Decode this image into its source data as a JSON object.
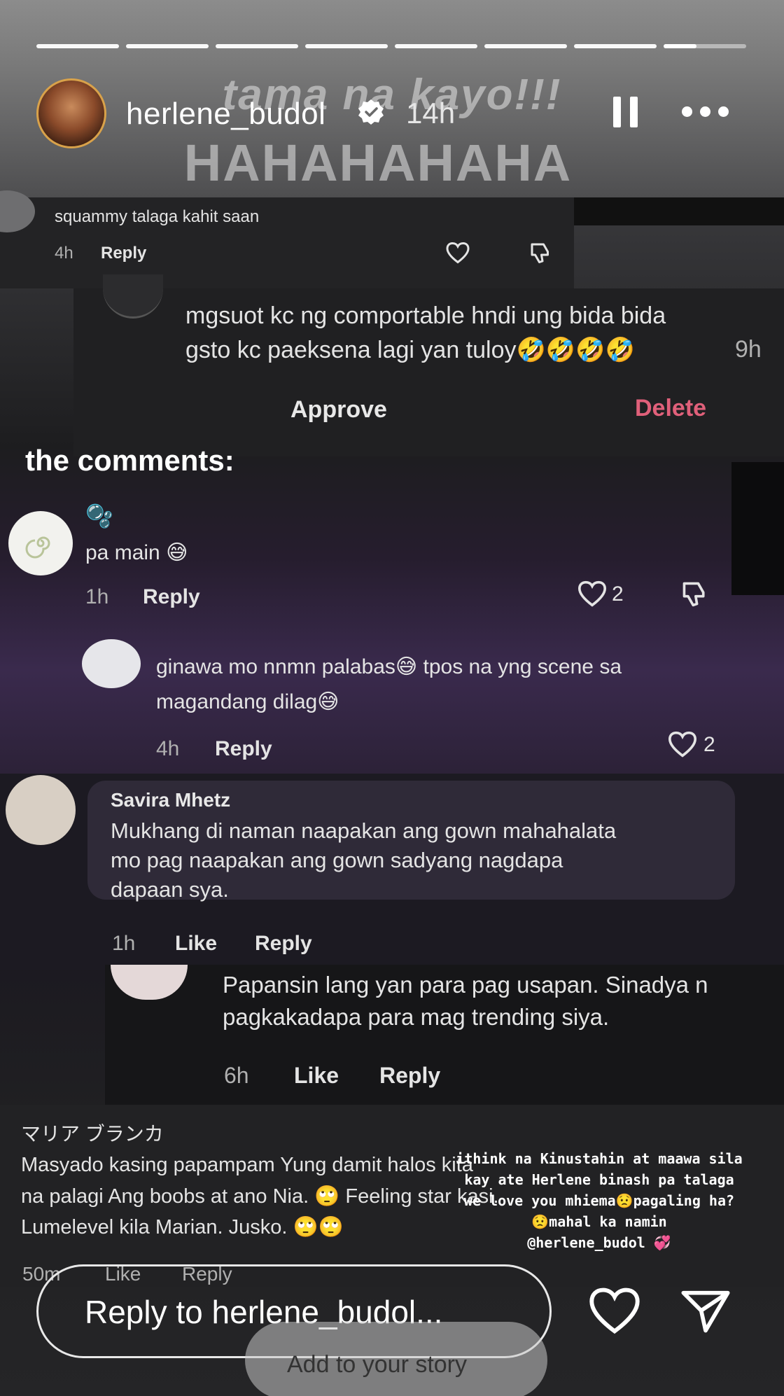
{
  "story": {
    "username": "herlene_budol",
    "time": "14h",
    "overlay_line1": "tama na kayo!!!",
    "overlay_line2": "HAHAHAHAHA",
    "section_label": "the comments:",
    "progress": {
      "segments": 8,
      "current_segment": 8,
      "current_fraction": 0.4
    }
  },
  "comments": {
    "c1": {
      "text": "squammy talaga kahit saan",
      "time": "4h",
      "reply": "Reply"
    },
    "c2": {
      "line1": "mgsuot kc ng comportable hndi ung bida bida",
      "line2": "gsto kc paeksena lagi yan tuloy🤣🤣🤣🤣",
      "time": "9h",
      "approve": "Approve",
      "delete": "Delete"
    },
    "c3": {
      "name_emoji": "🫧",
      "text": "pa main 😅",
      "time": "1h",
      "reply": "Reply",
      "likes": "2"
    },
    "c4": {
      "line1": "ginawa mo nnmn palabas😅 tpos na yng scene sa",
      "line2": "magandang dilag😅",
      "time": "4h",
      "reply": "Reply",
      "likes": "2"
    },
    "c5": {
      "name": "Savira Mhetz",
      "line1": "Mukhang di naman naapakan ang gown mahahalata",
      "line2": "mo pag naapakan ang gown sadyang nagdapa",
      "line3": "dapaan sya.",
      "time": "1h",
      "like": "Like",
      "reply": "Reply"
    },
    "c6": {
      "line1": "Papansin lang yan para pag usapan. Sinadya n",
      "line2": "pagkakadapa para mag trending siya.",
      "time": "6h",
      "like": "Like",
      "reply": "Reply"
    },
    "c7": {
      "name": "マリア ブランカ",
      "line1": "Masyado kasing papampam Yung damit halos kita",
      "line2": "na palagi Ang boobs at ano Nia. 🙄 Feeling star kasi.",
      "line3": "Lumelevel kila Marian. Jusko. 🙄🙄",
      "time": "50m",
      "like": "Like",
      "reply": "Reply"
    }
  },
  "caption": {
    "line1": "ithink na Kinustahin at maawa sila",
    "line2": "kay ate Herlene binash pa talaga",
    "line3": "we love you mhiema😟pagaling ha?",
    "line4": "😟mahal ka namin",
    "line5": "@herlene_budol 💞"
  },
  "footer": {
    "reply_placeholder": "Reply to herlene_budol...",
    "add_story": "Add to your story"
  },
  "colors": {
    "delete": "#e0607a",
    "text": "#e4e4e4",
    "muted": "#b0b0b0"
  }
}
